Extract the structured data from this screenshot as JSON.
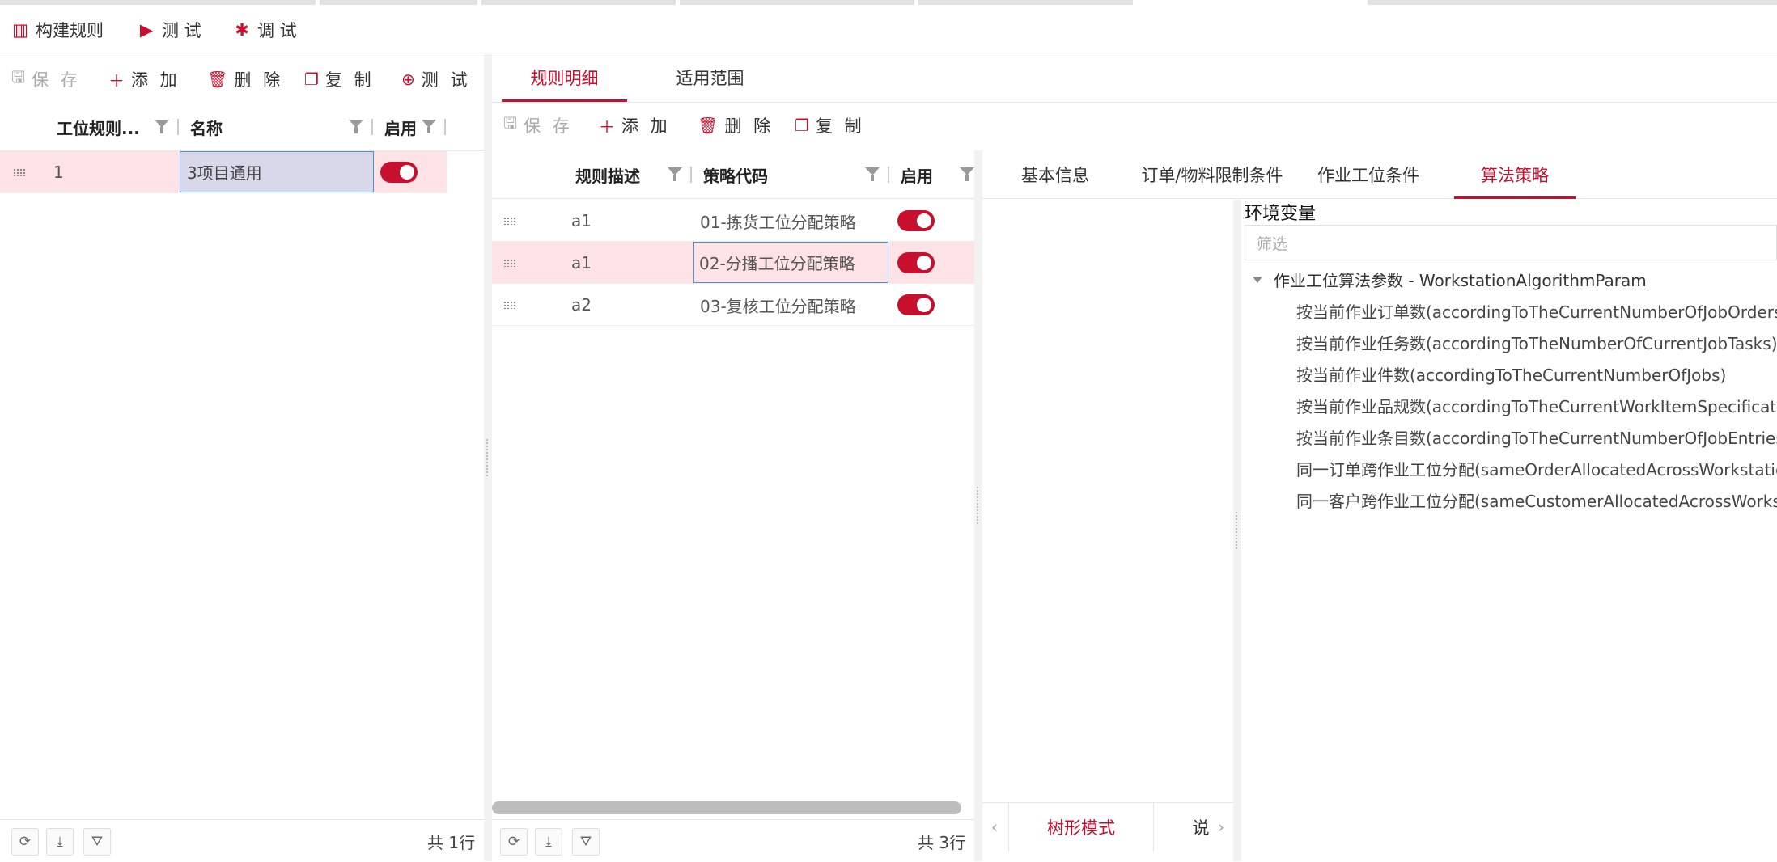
{
  "top_toolbar": {
    "build_rule": "构建规则",
    "test": "测 试",
    "debug": "调 试"
  },
  "left": {
    "actions": {
      "save": "保 存",
      "add": "添 加",
      "delete": "删 除",
      "copy": "复 制",
      "test": "测 试"
    },
    "columns": [
      "工位规则...",
      "名称",
      "启用"
    ],
    "rows": [
      {
        "id": "1",
        "name": "3项目通用",
        "enabled": true
      }
    ],
    "footer_count": "共 1行"
  },
  "middle": {
    "tabs": [
      "规则明细",
      "适用范围"
    ],
    "actions": {
      "save": "保 存",
      "add": "添 加",
      "delete": "删 除",
      "copy": "复 制"
    },
    "columns": [
      "规则描述",
      "策略代码",
      "启用"
    ],
    "rows": [
      {
        "desc": "a1",
        "code": "01-拣货工位分配策略",
        "enabled": true
      },
      {
        "desc": "a1",
        "code": "02-分播工位分配策略",
        "enabled": true
      },
      {
        "desc": "a2",
        "code": "03-复核工位分配策略",
        "enabled": true
      }
    ],
    "footer_count": "共 3行"
  },
  "right": {
    "tabs": [
      "基本信息",
      "订单/物料限制条件",
      "作业工位条件",
      "算法策略"
    ],
    "active_tab": "算法策略",
    "env_title": "环境变量",
    "filter_placeholder": "筛选",
    "tree_root": "作业工位算法参数 - WorkstationAlgorithmParam",
    "tree_items": [
      "按当前作业订单数(accordingToTheCurrentNumberOfJobOrders)",
      "按当前作业任务数(accordingToTheNumberOfCurrentJobTasks)",
      "按当前作业件数(accordingToTheCurrentNumberOfJobs)",
      "按当前作业品规数(accordingToTheCurrentWorkItemSpecifications)",
      "按当前作业条目数(accordingToTheCurrentNumberOfJobEntries)",
      "同一订单跨作业工位分配(sameOrderAllocatedAcrossWorkstations)",
      "同一客户跨作业工位分配(sameCustomerAllocatedAcrossWorkstations)"
    ],
    "bottom_tabs": [
      "树形模式",
      "说"
    ]
  },
  "colors": {
    "accent": "#c8102e",
    "selected_row": "#fde3e5",
    "edit_cell": "#d9d8ea"
  }
}
